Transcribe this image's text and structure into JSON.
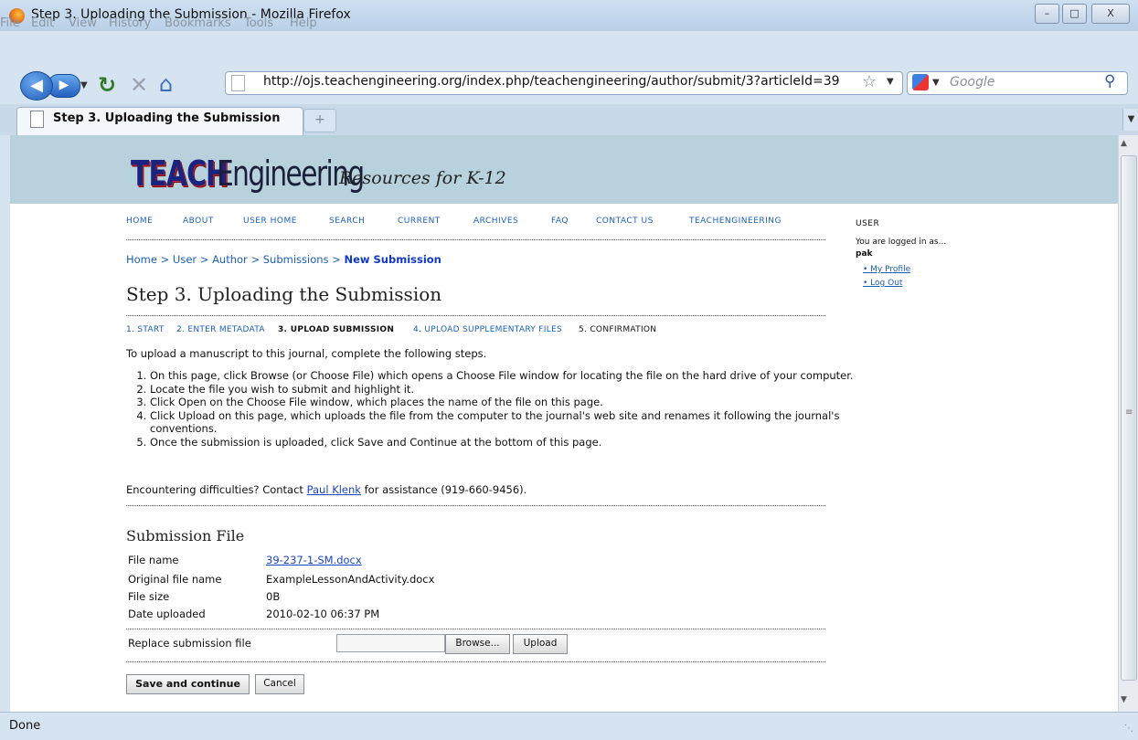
{
  "window": {
    "title": "Step 3. Uploading the Submission - Mozilla Firefox",
    "controls": {
      "minimize": "–",
      "maximize": "□",
      "close": "X"
    }
  },
  "menu": [
    "File",
    "Edit",
    "View",
    "History",
    "Bookmarks",
    "Tools",
    "Help"
  ],
  "toolbar": {
    "url": "http://ojs.teachengineering.org/index.php/teachengineering/author/submit/3?articleId=39",
    "search_placeholder": "Google"
  },
  "tab": {
    "label": "Step 3. Uploading the Submission",
    "new_tab": "+"
  },
  "header": {
    "logo_teach": "TEACH",
    "logo_engineering": "Engineering",
    "tagline": "Resources for K-12"
  },
  "nav": [
    "HOME",
    "ABOUT",
    "USER HOME",
    "SEARCH",
    "CURRENT",
    "ARCHIVES",
    "FAQ",
    "CONTACT US",
    "TEACHENGINEERING"
  ],
  "breadcrumb": {
    "trail": "Home > User > Author > Submissions > ",
    "current": "New Submission"
  },
  "page_title": "Step 3. Uploading the Submission",
  "steps_nav": [
    {
      "label": "1. START",
      "active": false
    },
    {
      "label": "2. ENTER METADATA",
      "active": false
    },
    {
      "label": "3. UPLOAD SUBMISSION",
      "active": true
    },
    {
      "label": "4. UPLOAD SUPPLEMENTARY FILES",
      "active": false
    },
    {
      "label": "5. CONFIRMATION",
      "active": false
    }
  ],
  "intro": "To upload a manuscript to this journal, complete the following steps.",
  "instructions": [
    "On this page, click Browse (or Choose File) which opens a Choose File window for locating the file on the hard drive of your computer.",
    "Locate the file you wish to submit and highlight it.",
    "Click Open on the Choose File window, which places the name of the file on this page.",
    "Click Upload on this page, which uploads the file from the computer to the journal's web site and renames it following the journal's conventions.",
    "Once the submission is uploaded, click Save and Continue at the bottom of this page."
  ],
  "difficulty": {
    "before": "Encountering difficulties? Contact ",
    "contact": "Paul Klenk",
    "after": " for assistance (919-660-9456)."
  },
  "submission_file": {
    "heading": "Submission File",
    "rows": [
      {
        "label": "File name",
        "value": "39-237-1-SM.docx"
      },
      {
        "label": "Original file name",
        "value": "ExampleLessonAndActivity.docx"
      },
      {
        "label": "File size",
        "value": "0B"
      },
      {
        "label": "Date uploaded",
        "value": "2010-02-10 06:37 PM"
      }
    ],
    "replace_label": "Replace submission file",
    "browse": "Browse...",
    "upload": "Upload"
  },
  "actions": {
    "save": "Save and continue",
    "cancel": "Cancel"
  },
  "sidebar": {
    "heading": "USER",
    "logged_in": "You are logged in as...",
    "username": "pak",
    "profile": "My Profile",
    "logout": "Log Out"
  },
  "status": "Done"
}
